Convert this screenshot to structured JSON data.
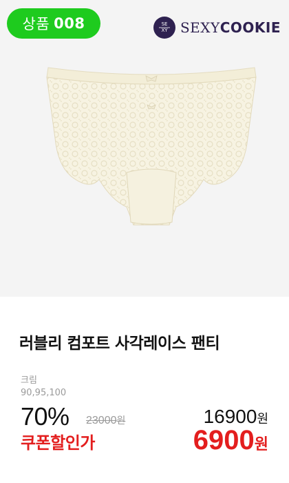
{
  "badge": {
    "label": "상품",
    "number": "008",
    "color": "#1ecb1e"
  },
  "brand": {
    "text_light": "SEXY",
    "text_bold": "COOKIE",
    "logo_icon": "sexycookie-logo-icon",
    "color": "#2e2150"
  },
  "product": {
    "title": "러블리 컴포트 사각레이스 팬티",
    "color": "크림",
    "sizes": "90,95,100",
    "image_icon": "lace-panty-image"
  },
  "pricing": {
    "discount": "70%",
    "original_price": "23000",
    "sale_price": "16900",
    "coupon_label": "쿠폰할인가",
    "coupon_price": "6900",
    "currency": "원",
    "accent_color": "#e31e1e"
  }
}
